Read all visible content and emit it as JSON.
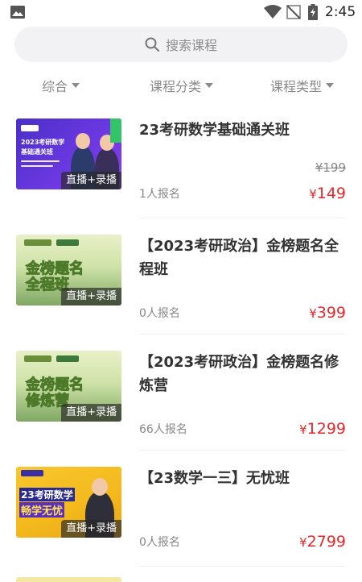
{
  "status_bar": {
    "time": "2:45",
    "icons": [
      "gallery-icon",
      "wifi-icon",
      "no-signal-icon",
      "battery-charging-icon"
    ]
  },
  "search": {
    "placeholder": "搜索课程",
    "icon": "search-icon"
  },
  "filters": [
    {
      "label": "综合",
      "icon": "caret-down-icon"
    },
    {
      "label": "课程分类",
      "icon": "caret-down-icon"
    },
    {
      "label": "课程类型",
      "icon": "caret-down-icon"
    }
  ],
  "courses": [
    {
      "title": "23考研数学基础通关班",
      "badge": "直播+录播",
      "original_price": "¥199",
      "enroll": "1人报名",
      "price_symbol": "¥",
      "price": "149",
      "thumb_text": [
        "2023考研数学",
        "基础通关班"
      ]
    },
    {
      "title": "【2023考研政治】金榜题名全程班",
      "badge": "直播+录播",
      "original_price": "",
      "enroll": "0人报名",
      "price_symbol": "¥",
      "price": "399",
      "thumb_text": [
        "金榜题名",
        "全程班"
      ]
    },
    {
      "title": "【2023考研政治】金榜题名修炼营",
      "badge": "直播+录播",
      "original_price": "",
      "enroll": "66人报名",
      "price_symbol": "¥",
      "price": "1299",
      "thumb_text": [
        "金榜题名",
        "修炼营"
      ]
    },
    {
      "title": "【23数学一三】无忧班",
      "badge": "直播+录播",
      "original_price": "",
      "enroll": "0人报名",
      "price_symbol": "¥",
      "price": "2799",
      "thumb_text": [
        "23考研数学",
        "畅学无忧"
      ]
    }
  ],
  "colors": {
    "accent_price": "#e8262b",
    "search_bg": "#f2f2f4",
    "muted_text": "#8a8a8a"
  }
}
